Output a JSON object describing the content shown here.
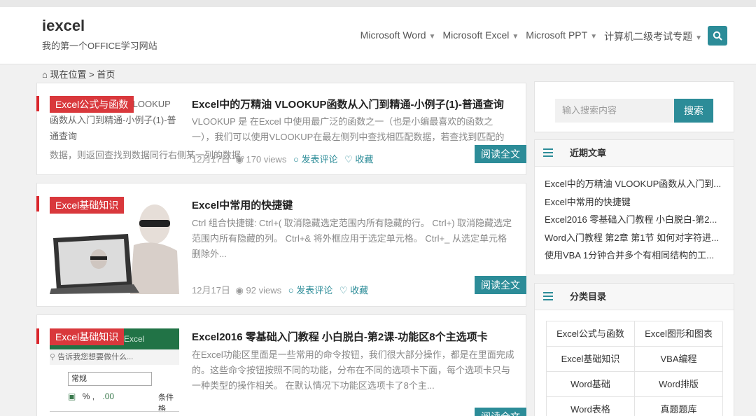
{
  "site": {
    "title": "iexcel",
    "tagline": "我的第一个OFFICE学习网站"
  },
  "nav": [
    {
      "label": "Microsoft Word"
    },
    {
      "label": "Microsoft Excel"
    },
    {
      "label": "Microsoft PPT"
    },
    {
      "label": "计算机二级考试专题"
    }
  ],
  "breadcrumb": {
    "label": "现在位置",
    "sep": ">",
    "current": "首页"
  },
  "posts": [
    {
      "category": "Excel公式与函数",
      "thumb_text": "VLOOKUP函数从入门到精通-小例子(1)-普通查询",
      "thumb_tail": "数据，则返回查找到数据同行右侧某一列的数据。",
      "title": "Excel中的万精油 VLOOKUP函数从入门到精通-小例子(1)-普通查询",
      "excerpt": "VLOOKUP 是 在Excel 中使用最广泛的函数之一（也是小编最喜欢的函数之一），我们可以使用VLOOKUP在最左侧列中查找相匹配数据，若查找到匹配的",
      "date": "12月17日",
      "views": "170 views",
      "comment": "发表评论",
      "fav": "收藏",
      "read": "阅读全文"
    },
    {
      "category": "Excel基础知识",
      "title": "Excel中常用的快捷键",
      "excerpt": "Ctrl 组合快捷键: Ctrl+( 取消隐藏选定范围内所有隐藏的行。 Ctrl+) 取消隐藏选定范围内所有隐藏的列。 Ctrl+& 将外框应用于选定单元格。 Ctrl+_ 从选定单元格删除外...",
      "date": "12月17日",
      "views": "92 views",
      "comment": "发表评论",
      "fav": "收藏",
      "read": "阅读全文"
    },
    {
      "category": "Excel基础知识",
      "thumb_app": "Excel",
      "thumb_tell": "告诉我您想要做什么...",
      "thumb_fmt": "常规",
      "thumb_pct": "% ,",
      "thumb_cond": "条件格",
      "title": "Excel2016 零基础入门教程 小白脱白-第2课-功能区8个主选项卡",
      "excerpt": "在Excel功能区里面是一些常用的命令按钮，我们很大部分操作，都是在里面完成的。这些命令按钮按照不同的功能，分布在不同的选项卡下面，每个选项卡只与一种类型的操作相关。 在默认情况下功能区选项卡了8个主...",
      "read": "阅读全文"
    }
  ],
  "sidebar": {
    "search_placeholder": "输入搜索内容",
    "search_button": "搜索",
    "recent_title": "近期文章",
    "recent": [
      "Excel中的万精油 VLOOKUP函数从入门到...",
      "Excel中常用的快捷键",
      "Excel2016 零基础入门教程 小白脱白-第2...",
      "Word入门教程 第2章 第1节 如何对字符进...",
      "使用VBA 1分钟合并多个有相同结构的工..."
    ],
    "cat_title": "分类目录",
    "categories": [
      "Excel公式与函数",
      "Excel图形和图表",
      "Excel基础知识",
      "VBA编程",
      "Word基础",
      "Word排版",
      "Word表格",
      "真题题库"
    ]
  },
  "colors": {
    "accent": "#2c8c98",
    "red": "#d9383c"
  }
}
